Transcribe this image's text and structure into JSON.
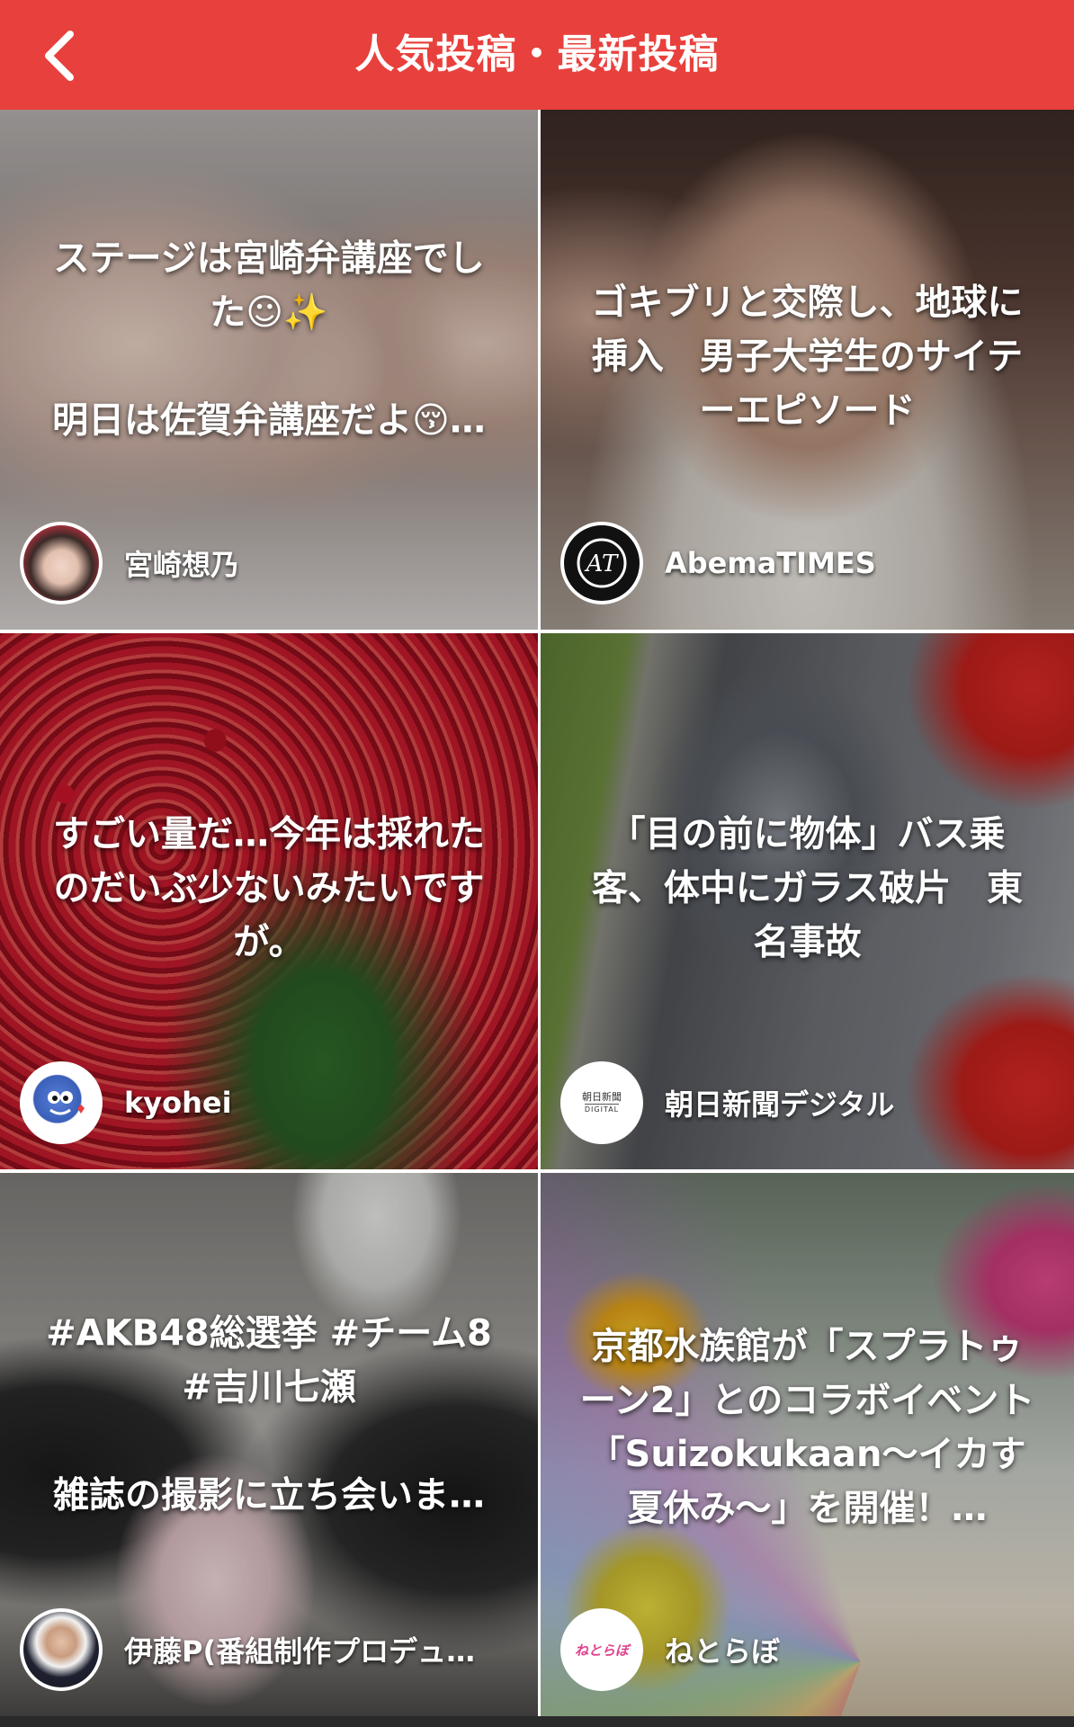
{
  "header": {
    "title": "人気投稿・最新投稿",
    "back_icon": "chevron-left-icon",
    "background_color": "#e8403c"
  },
  "cards": [
    {
      "text": "ステージは宮崎弁講座でした☺✨\n\n明日は佐賀弁講座だよ😚…",
      "author": "宮崎想乃",
      "avatar_style": "photo-portrait"
    },
    {
      "text": "ゴキブリと交際し、地球に挿入　男子大学生のサイテーエピソード",
      "author": "AbemaTIMES",
      "avatar_style": "abematimes-logo"
    },
    {
      "text": "すごい量だ…今年は採れたのだいぶ少ないみたいですが。",
      "author": "kyohei",
      "avatar_style": "monster-illustration"
    },
    {
      "text": "「目の前に物体」バス乗客、体中にガラス破片　東名事故",
      "author": "朝日新聞デジタル",
      "avatar_style": "asahi-digital-logo",
      "avatar_logo_line1": "朝日新聞",
      "avatar_logo_line2": "DIGITAL"
    },
    {
      "text": "#AKB48総選挙 #チーム8 #吉川七瀬\n\n雑誌の撮影に立ち会いま…",
      "author": "伊藤P(番組制作プロデュ…",
      "avatar_style": "photo-man"
    },
    {
      "text": "京都水族館が「スプラトゥーン2」とのコラボイベント「Suizokukaan〜イカす夏休み〜」を開催！…",
      "author": "ねとらぼ",
      "avatar_style": "netorabo-logo",
      "avatar_logo_text": "ねとらぼ"
    }
  ]
}
